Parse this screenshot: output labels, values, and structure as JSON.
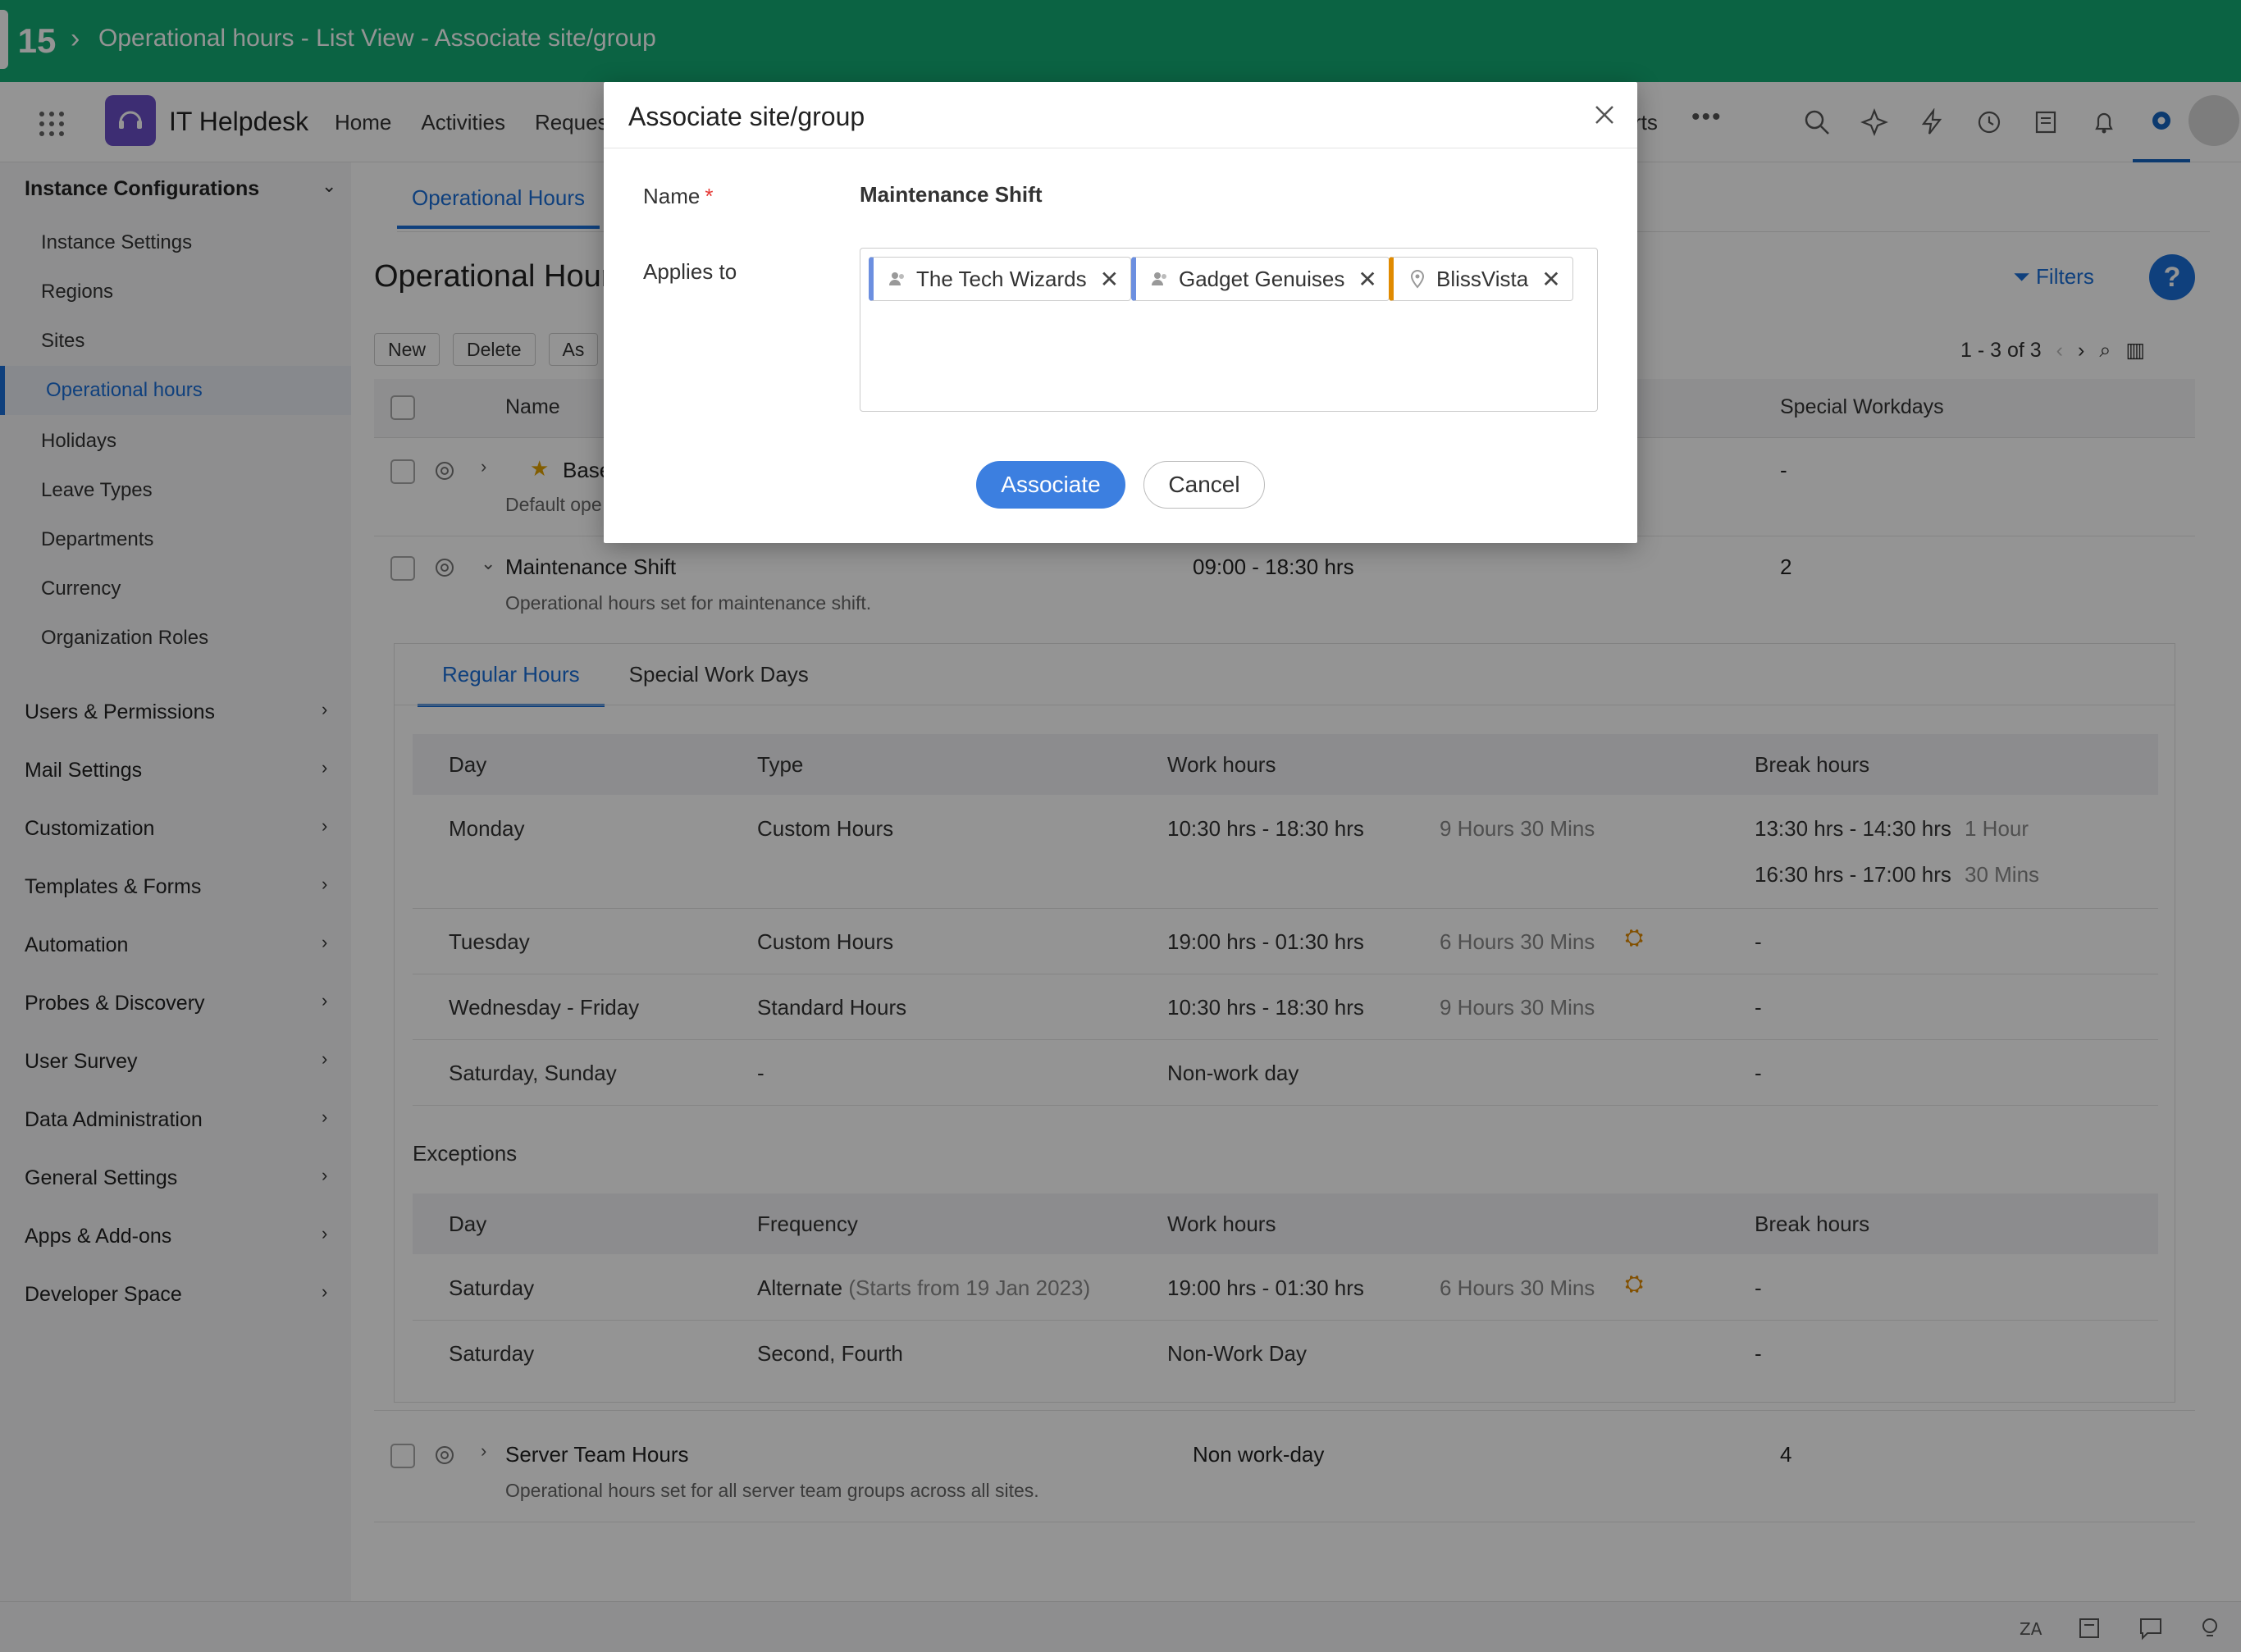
{
  "topbar": {
    "count": "15",
    "title": "Operational hours - List View - Associate site/group"
  },
  "header": {
    "app_name": "IT Helpdesk",
    "nav": [
      "Home",
      "Activities",
      "Request"
    ],
    "reports_partial": "rts",
    "more": "•••",
    "icons": [
      "search-icon",
      "ai-sparkle-icon",
      "lightning-icon",
      "history-icon",
      "notes-icon",
      "bell-icon",
      "gear-icon"
    ]
  },
  "sidebar": {
    "section_title": "Instance Configurations",
    "items": [
      "Instance Settings",
      "Regions",
      "Sites",
      "Operational hours",
      "Holidays",
      "Leave Types",
      "Departments",
      "Currency",
      "Organization Roles"
    ],
    "active_item": "Operational hours",
    "groups": [
      "Users & Permissions",
      "Mail Settings",
      "Customization",
      "Templates & Forms",
      "Automation",
      "Probes & Discovery",
      "User Survey",
      "Data Administration",
      "General Settings",
      "Apps & Add-ons",
      "Developer Space"
    ]
  },
  "main": {
    "tab": "Operational Hours",
    "page_title": "Operational Hours",
    "filters_label": "Filters",
    "help": "?",
    "buttons": [
      "New",
      "Delete",
      "As"
    ],
    "pager": "1 - 3 of 3",
    "columns": {
      "name": "Name",
      "special": "Special Workdays"
    },
    "rows": [
      {
        "name": "Base C",
        "desc": "Default ope",
        "work": "",
        "special": "-"
      },
      {
        "name": "Maintenance Shift",
        "desc": "Operational hours set for maintenance shift.",
        "work": "09:00 - 18:30 hrs",
        "special": "2"
      },
      {
        "name": "Server Team Hours",
        "desc": "Operational hours set for all server team groups across all sites.",
        "work": "Non work-day",
        "special": "4"
      }
    ]
  },
  "detail": {
    "tabs": [
      "Regular Hours",
      "Special Work Days"
    ],
    "regular_headers": [
      "Day",
      "Type",
      "Work hours",
      "Break hours"
    ],
    "regular_rows": [
      {
        "day": "Monday",
        "type": "Custom Hours",
        "work": "10:30 hrs - 18:30 hrs",
        "dur": "9 Hours 30 Mins",
        "break1": "13:30 hrs - 14:30 hrs",
        "break1_dur": "1 Hour",
        "break2": "16:30 hrs - 17:00 hrs",
        "break2_dur": "30 Mins"
      },
      {
        "day": "Tuesday",
        "type": "Custom Hours",
        "work": "19:00 hrs - 01:30 hrs",
        "dur": "6 Hours 30 Mins",
        "break": "-"
      },
      {
        "day": "Wednesday - Friday",
        "type": "Standard Hours",
        "work": "10:30 hrs - 18:30 hrs",
        "dur": "9 Hours 30 Mins",
        "break": "-"
      },
      {
        "day": "Saturday, Sunday",
        "type": "-",
        "work": "Non-work day",
        "break": "-"
      }
    ],
    "exceptions_title": "Exceptions",
    "exception_headers": [
      "Day",
      "Frequency",
      "Work hours",
      "Break hours"
    ],
    "exception_rows": [
      {
        "day": "Saturday",
        "freq": "Alternate",
        "freq_note": "(Starts from 19 Jan 2023)",
        "work": "19:00 hrs - 01:30 hrs",
        "dur": "6 Hours 30 Mins",
        "break": "-"
      },
      {
        "day": "Saturday",
        "freq": "Second, Fourth",
        "work": "Non-Work Day",
        "break": "-"
      }
    ]
  },
  "footer": {
    "icons": [
      "translate-icon",
      "notes-icon",
      "chat-icon",
      "bulb-icon"
    ]
  },
  "modal": {
    "title": "Associate site/group",
    "name_label": "Name",
    "required_mark": "*",
    "name_value": "Maintenance Shift",
    "applies_label": "Applies to",
    "tags": [
      {
        "label": "The Tech Wizards",
        "kind": "group"
      },
      {
        "label": "Gadget Genuises",
        "kind": "group"
      },
      {
        "label": "BlissVista",
        "kind": "site"
      }
    ],
    "remove_glyph": "✕",
    "associate_label": "Associate",
    "cancel_label": "Cancel"
  }
}
